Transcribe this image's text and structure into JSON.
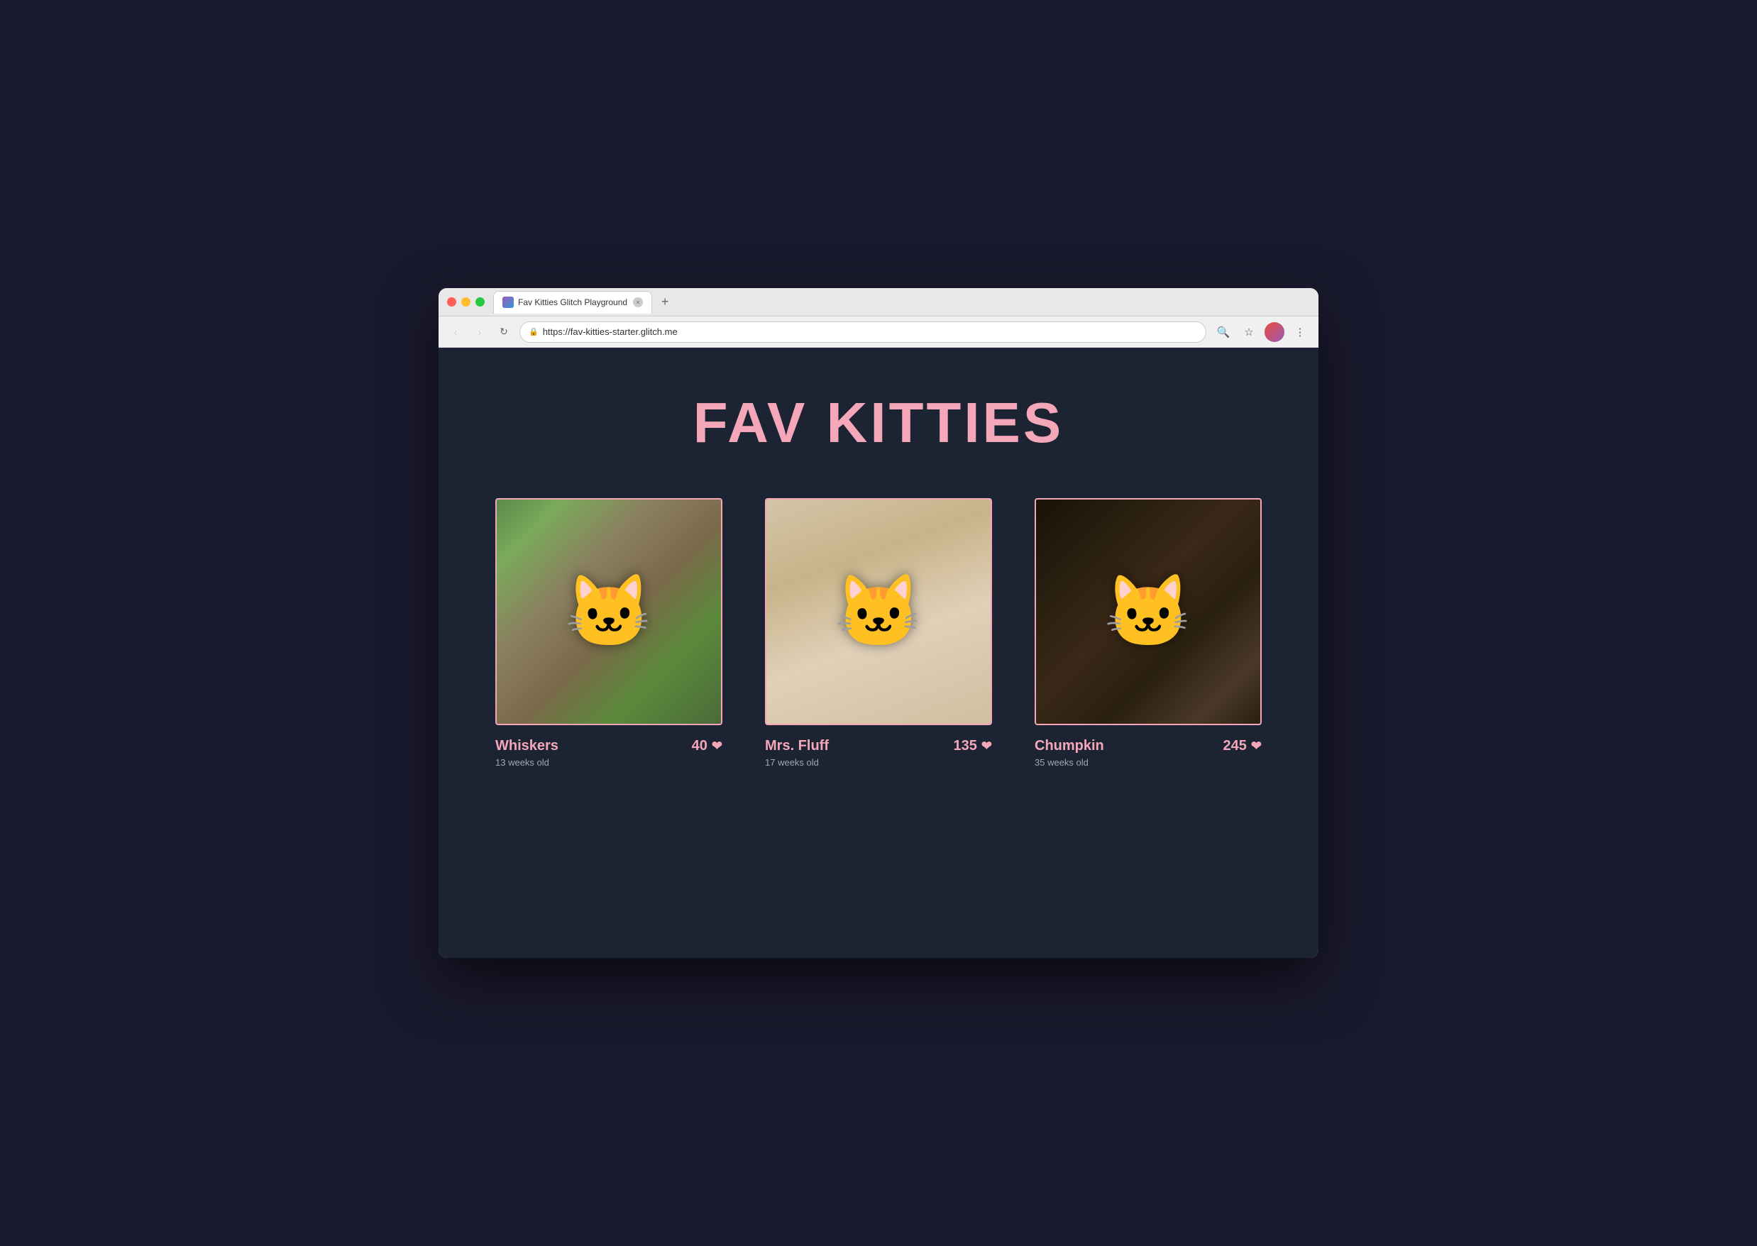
{
  "browser": {
    "tab_title": "Fav Kitties Glitch Playground",
    "tab_close_label": "×",
    "tab_new_label": "+",
    "url": "https://fav-kitties-starter.glitch.me",
    "nav": {
      "back_label": "‹",
      "forward_label": "›",
      "refresh_label": "↻"
    },
    "actions": {
      "search_label": "🔍",
      "bookmark_label": "☆",
      "menu_label": "⋮"
    }
  },
  "page": {
    "title": "FAV KITTIES",
    "background_color": "#1c2333",
    "accent_color": "#f4a7b9"
  },
  "kitties": [
    {
      "id": "whiskers",
      "name": "Whiskers",
      "age": "13 weeks old",
      "votes": "40",
      "border_color": "#f4a7b9",
      "image_emoji": "🐱",
      "image_bg": "linear-gradient(135deg, #5a8a4a 0%, #7aaa5a 15%, #8b8060 35%, #7a6a4a 55%, #5a8a3a 75%, #4a6a3a 100%)"
    },
    {
      "id": "mrs-fluff",
      "name": "Mrs. Fluff",
      "age": "17 weeks old",
      "votes": "135",
      "border_color": "#f4a7b9",
      "image_emoji": "🐱",
      "image_bg": "linear-gradient(160deg, #d4c4a8 0%, #c8b48a 30%, #e0d0b8 60%, #d0bfa0 100%)"
    },
    {
      "id": "chumpkin",
      "name": "Chumpkin",
      "age": "35 weeks old",
      "votes": "245",
      "border_color": "#f4a7b9",
      "image_emoji": "🐱",
      "image_bg": "linear-gradient(135deg, #1a1208 0%, #2a2010 25%, #3a2818 45%, #2a2010 65%, #4a3828 85%, #2a2010 100%)"
    }
  ]
}
